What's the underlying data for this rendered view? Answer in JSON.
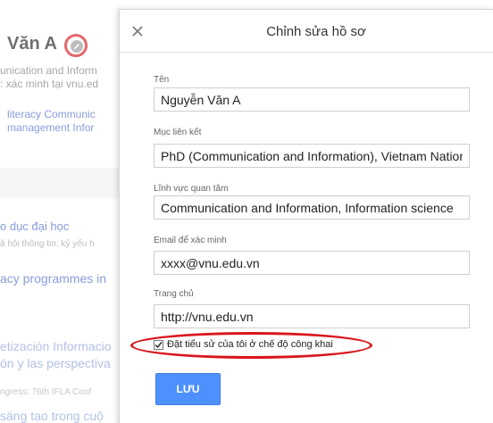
{
  "background": {
    "profile_name": "Văn A",
    "affiliation": "unication and Inform",
    "verified": ": xác minh tại vnu.ed",
    "keywords_line1": "literacy   Communic",
    "keywords_line2": "management   Infor",
    "list": [
      "o dục đại học",
      "ã hội thông tin: kỷ yếu h",
      "acy programmes in",
      "etización Informacio",
      "ón y las perspectiva",
      "ngress: 76th IFLA Conf",
      "sáng tạo trong cuộ"
    ]
  },
  "dialog": {
    "title": "Chỉnh sửa hồ sơ",
    "fields": {
      "name": {
        "label": "Tên",
        "value": "Nguyễn Văn A"
      },
      "affiliation": {
        "label": "Mục liên kết",
        "value": "PhD (Communication and Information), Vietnam National University"
      },
      "interests": {
        "label": "Lĩnh vực quan tâm",
        "value": "Communication and Information, Information science"
      },
      "email": {
        "label": "Email để xác minh",
        "value": "xxxx@vnu.edu.vn"
      },
      "homepage": {
        "label": "Trang chủ",
        "value": "http://vnu.edu.vn"
      }
    },
    "public_checkbox": {
      "label": "Đặt tiểu sử của tôi ở chế độ công khai",
      "checked": true
    },
    "save_label": "LƯU"
  },
  "colors": {
    "annotation_red": "#d9161c",
    "primary_blue": "#4d90fe",
    "link_blue": "#4a67c9"
  }
}
